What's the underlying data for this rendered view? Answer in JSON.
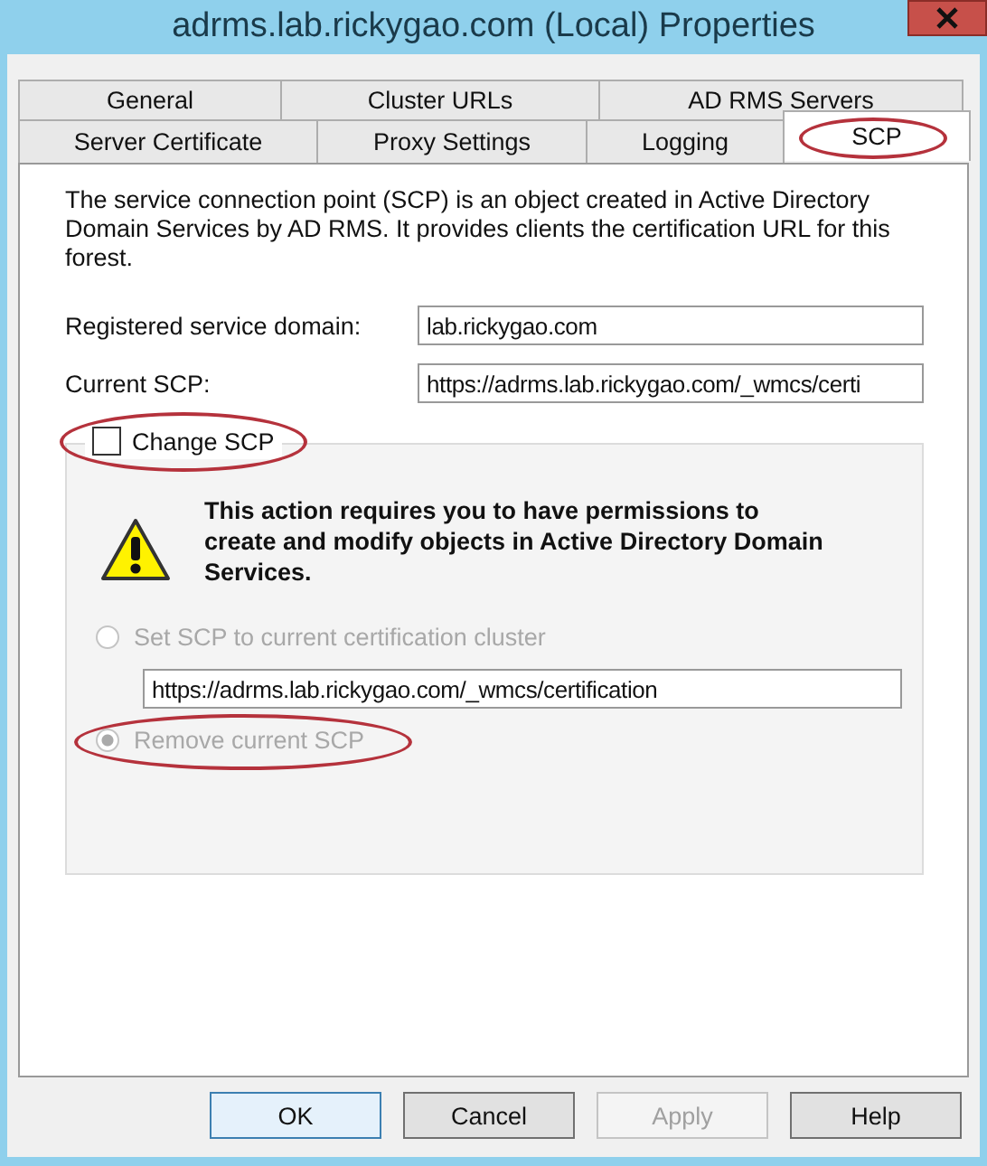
{
  "window": {
    "title": "adrms.lab.rickygao.com (Local) Properties"
  },
  "tab_rows": [
    [
      {
        "label": "General",
        "selected": false,
        "highlighted": false
      },
      {
        "label": "Cluster URLs",
        "selected": false,
        "highlighted": false
      },
      {
        "label": "AD RMS Servers",
        "selected": false,
        "highlighted": false
      }
    ],
    [
      {
        "label": "Server Certificate",
        "selected": false,
        "highlighted": false
      },
      {
        "label": "Proxy Settings",
        "selected": false,
        "highlighted": false
      },
      {
        "label": "Logging",
        "selected": false,
        "highlighted": false
      },
      {
        "label": "SCP",
        "selected": true,
        "highlighted": true
      }
    ]
  ],
  "description": "The service connection point (SCP) is an object created in Active Directory Domain Services by AD RMS. It provides clients the certification URL for this forest.",
  "fields": [
    {
      "label": "Registered service domain:",
      "value": "lab.rickygao.com"
    },
    {
      "label": "Current SCP:",
      "value": "https://adrms.lab.rickygao.com/_wmcs/certi"
    }
  ],
  "change_scp": {
    "label": "Change SCP",
    "checked": false,
    "highlighted": true
  },
  "warning": "This action requires you to have permissions to create and modify objects in Active Directory Domain Services.",
  "options": [
    {
      "label": "Set SCP to current certification cluster",
      "selected": false,
      "disabled": true,
      "highlighted": false,
      "url": "https://adrms.lab.rickygao.com/_wmcs/certification"
    },
    {
      "label": "Remove current SCP",
      "selected": true,
      "disabled": true,
      "highlighted": true
    }
  ],
  "buttons": [
    {
      "label": "OK",
      "disabled": false,
      "default": true
    },
    {
      "label": "Cancel",
      "disabled": false,
      "default": false
    },
    {
      "label": "Apply",
      "disabled": true,
      "default": false
    },
    {
      "label": "Help",
      "disabled": false,
      "default": false
    }
  ]
}
